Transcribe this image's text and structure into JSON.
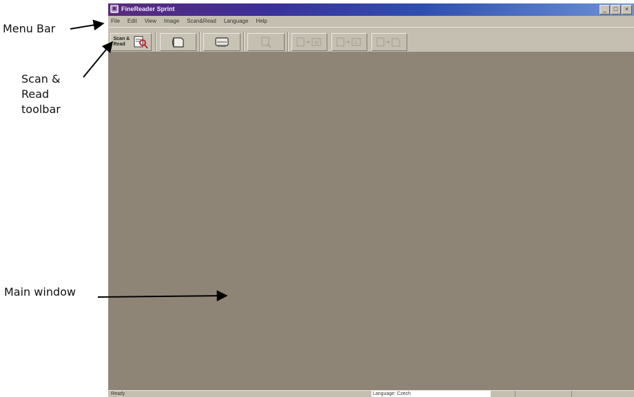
{
  "annotations": {
    "menu_bar": "Menu Bar",
    "scan_read_toolbar": "Scan &\nRead\ntoolbar",
    "main_window": "Main window"
  },
  "window": {
    "title": "FineReader Sprint",
    "controls": [
      "_",
      "□",
      "×"
    ]
  },
  "menu": [
    "File",
    "Edit",
    "View",
    "Image",
    "Scan&Read",
    "Language",
    "Help"
  ],
  "toolbar": {
    "scan_read_label": "Scan & Read",
    "buttons": [
      {
        "name": "scan-read",
        "icon": "scan-read-icon",
        "enabled": true
      },
      {
        "name": "open-image",
        "icon": "open-image-icon",
        "enabled": true
      },
      {
        "name": "scan",
        "icon": "scanner-icon",
        "enabled": true
      },
      {
        "name": "read",
        "icon": "read-icon",
        "enabled": false
      },
      {
        "name": "save-to-word",
        "icon": "word-icon",
        "enabled": false
      },
      {
        "name": "save-to-excel",
        "icon": "excel-icon",
        "enabled": false
      },
      {
        "name": "save-to-file",
        "icon": "file-icon",
        "enabled": false
      }
    ]
  },
  "status": {
    "text": "Ready",
    "language": "Language: Czech"
  },
  "colors": {
    "workspace": "#8f8577",
    "chrome": "#c4bfb1",
    "title_start": "#5c2a7a",
    "title_end": "#6d93d6"
  }
}
